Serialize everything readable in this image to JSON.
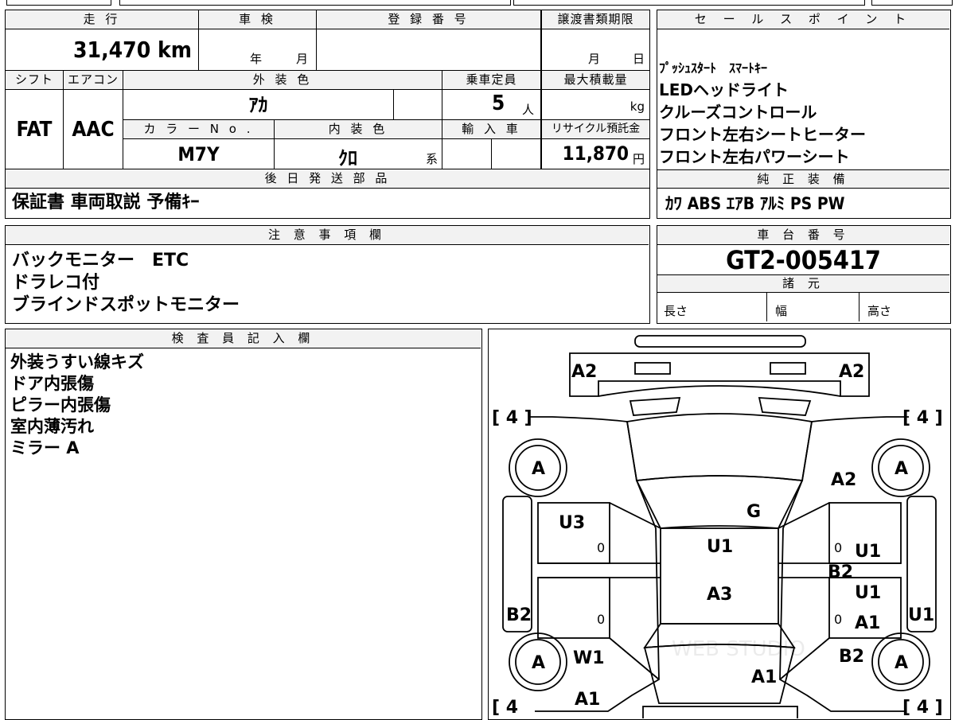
{
  "top_strip": {
    "partial_text": "■■■"
  },
  "basic": {
    "mileage_label": "走 行",
    "mileage_value": "31,470 km",
    "shaken_label": "車 検",
    "shaken_year": "年",
    "shaken_month": "月",
    "reg_label": "登 録 番 号",
    "reg_value": "",
    "transfer_label": "譲渡書類期限",
    "transfer_month": "月",
    "transfer_day": "日",
    "shift_label": "シフト",
    "shift_value": "FAT",
    "ac_label": "エアコン",
    "ac_value": "AAC",
    "exterior_label": "外 装 色",
    "exterior_value": "ｱｶ",
    "capacity_label": "乗車定員",
    "capacity_value": "5",
    "capacity_unit": "人",
    "load_label": "最大積載量",
    "load_unit": "kg",
    "color_no_label": "カ ラ ー N o .",
    "color_no_value": "M7Y",
    "interior_label": "内 装 色",
    "interior_value": "ｸﾛ",
    "interior_suffix": "系",
    "import_label": "輸 入 車",
    "recycle_label": "リサイクル預託金",
    "recycle_value": "11,870",
    "recycle_unit": "円",
    "later_parts_label": "後 日 発 送 部 品",
    "later_parts_value": "保証書 車両取説 予備ｷｰ"
  },
  "sales": {
    "label": "セ ー ル ス ポ イ ン ト",
    "lines": [
      "ﾌﾟｯｼｭｽﾀｰﾄ　ｽﾏｰﾄｷｰ",
      "LEDヘッドライト",
      "クルーズコントロール",
      "フロント左右シートヒーター",
      "フロント左右パワーシート"
    ],
    "equipment_label": "純 正 装 備",
    "equipment_value": "ｶﾜ ABS ｴｱB ｱﾙﾐ PS PW"
  },
  "notes": {
    "label": "注 意 事 項 欄",
    "lines": [
      "バックモニター　ETC",
      "ドラレコ付",
      "ブラインドスポットモニター"
    ]
  },
  "chassis": {
    "label": "車 台 番 号",
    "value": "GT2-005417",
    "specs_label": "諸 元",
    "length_label": "長さ",
    "width_label": "幅",
    "height_label": "高さ"
  },
  "inspector": {
    "label": "検 査 員 記 入 欄",
    "lines": [
      "外装うすい線キズ",
      "ドア内張傷",
      "ピラー内張傷",
      "室内薄汚れ",
      "ミラー A"
    ]
  },
  "diagram": {
    "marks": {
      "front_left": "A2",
      "front_right": "A2",
      "tire_fl": "A",
      "tire_fr": "A",
      "tire_rl": "A",
      "tire_rr": "A",
      "bracket_tl": "[ 4 ]",
      "bracket_tr": "[ 4 ]",
      "bracket_bl": "[ 4",
      "bracket_br": "[ 4 ]",
      "fender_r": "A2",
      "roof_g": "G",
      "door_fl": "U3",
      "door_zero_1": "0",
      "door_zero_2": "0",
      "door_zero_3": "0",
      "door_zero_4": "0",
      "roof_u1": "U1",
      "roof_a3": "A3",
      "door_fr": "U1",
      "pillar_r": "B2",
      "door_rr": "U1",
      "door_rr2": "A1",
      "side_l": "B2",
      "side_r": "U1",
      "rear_left": "W1",
      "rear_right": "B2",
      "trunk": "A1",
      "rear_bottom_l": "A1"
    },
    "watermark": "WEB STUDIO"
  }
}
